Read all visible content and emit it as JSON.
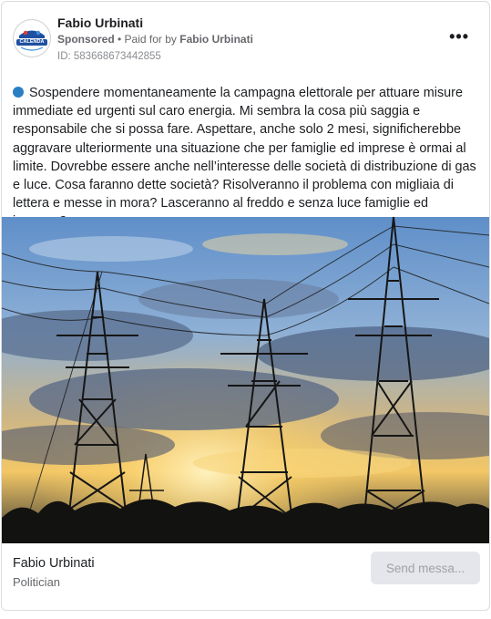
{
  "ad": {
    "page_name": "Fabio Urbinati",
    "sponsored_label": "Sponsored",
    "separator": " • ",
    "paid_for_label": "Paid for by ",
    "payer": "Fabio Urbinati",
    "ad_id": "ID: 583668673442855",
    "more_label": "•••",
    "avatar_logo_text": "CALENDA"
  },
  "post": {
    "text": "Sospendere momentaneamente la campagna elettorale per attuare misure immediate ed urgenti sul caro energia. Mi sembra la cosa più saggia e responsabile che si possa fare. Aspettare, anche solo 2 mesi, significherebbe aggravare ulteriormente una situazione che per famiglie ed imprese è ormai al limite. Dovrebbe essere anche nell’interesse delle società di distribuzione di gas e luce. Cosa faranno dette società? Risolveranno il problema con migliaia di lettera e messe in mora? Lasceranno al freddo e senza luce famiglie ed imprese?…"
  },
  "footer": {
    "name": "Fabio Urbinati",
    "subtitle": "Politician",
    "button_label": "Send messa..."
  },
  "colors": {
    "accent_dot": "#2a7fc4",
    "button_bg": "#e4e6eb"
  }
}
